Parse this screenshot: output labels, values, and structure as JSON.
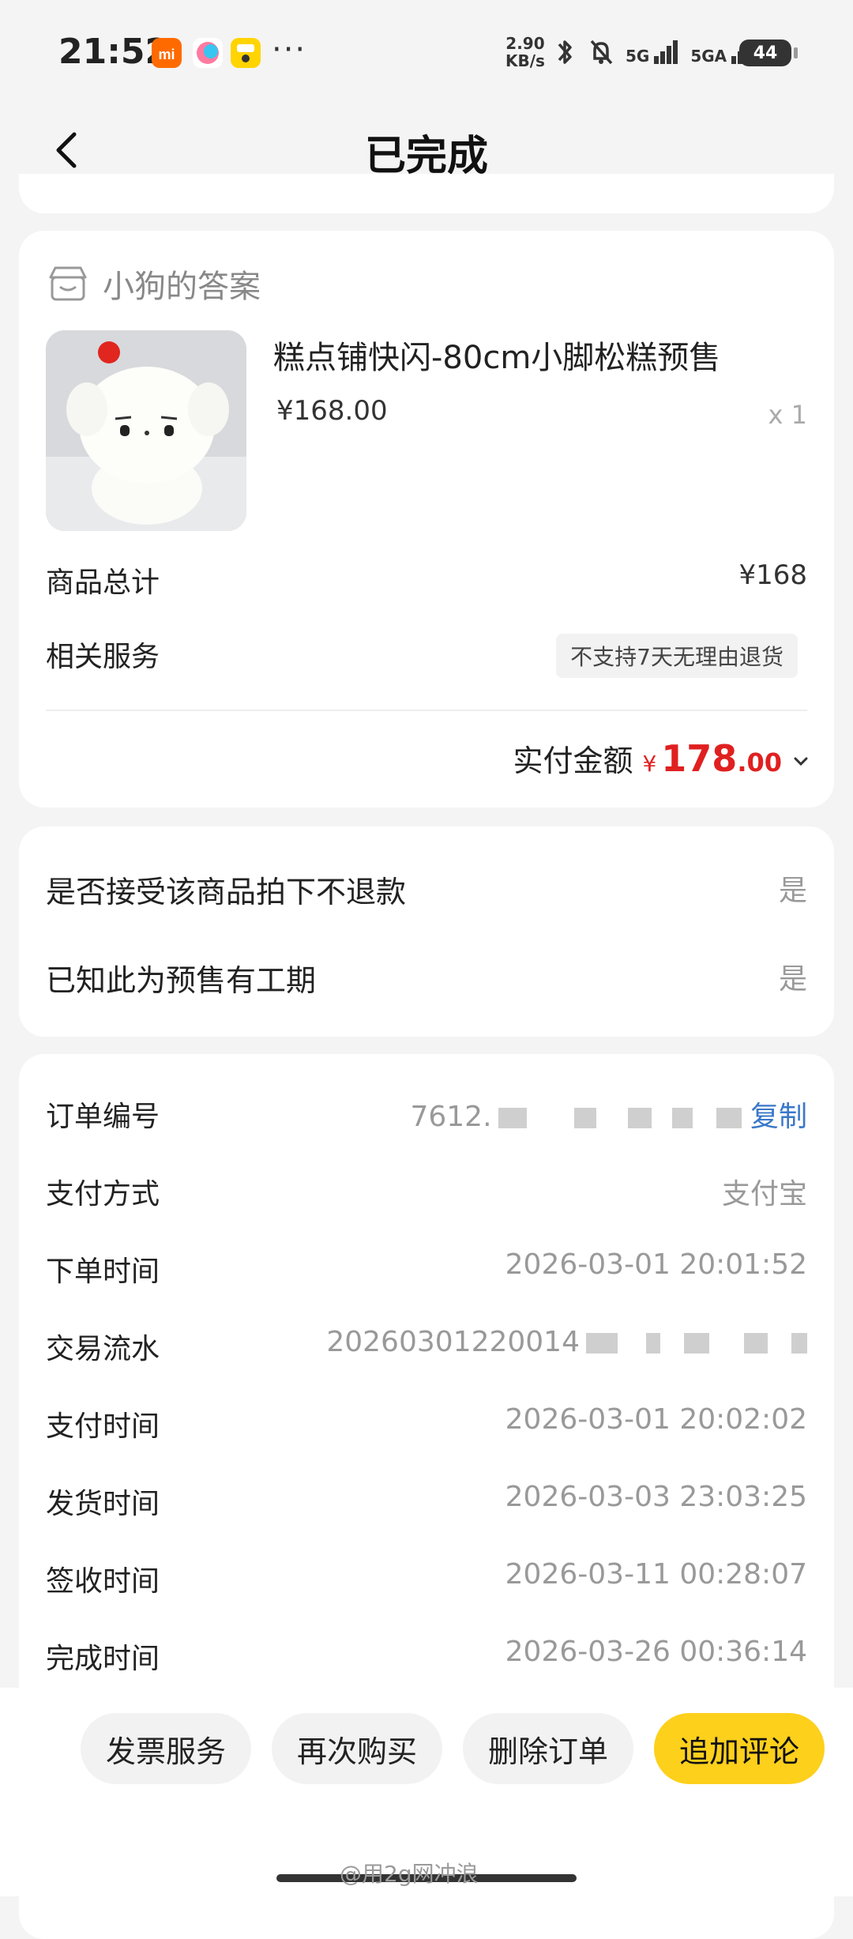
{
  "status_bar": {
    "time": "21:52",
    "net_speed": "2.90",
    "net_unit": "KB/s",
    "signal1_label": "5G",
    "signal2_label": "5GA",
    "battery": "44",
    "icons": [
      "mi-app-icon",
      "colorful-app-icon",
      "yellow-app-icon",
      "bluetooth-icon",
      "mute-bell-icon",
      "signal-icon"
    ]
  },
  "header": {
    "title": "已完成"
  },
  "product_card": {
    "shop_name": "小狗的答案",
    "product_title": "糕点铺快闪-80cm小脚松糕预售",
    "price": "¥168.00",
    "qty": "x 1",
    "total_label": "商品总计",
    "total_value": "¥168",
    "service_label": "相关服务",
    "service_tag": "不支持7天无理由退货",
    "paid_label": "实付金额",
    "paid_currency": "¥",
    "paid_int": "178",
    "paid_dec": ".00"
  },
  "options": [
    {
      "label": "是否接受该商品拍下不退款",
      "value": "是"
    },
    {
      "label": "已知此为预售有工期",
      "value": "是"
    }
  ],
  "order_info": {
    "order_no_label": "订单编号",
    "order_no_value": "7612.",
    "copy_label": "复制",
    "pay_method_label": "支付方式",
    "pay_method_value": "支付宝",
    "order_time_label": "下单时间",
    "order_time_value": "2026-03-01 20:01:52",
    "txn_label": "交易流水",
    "txn_value": "20260301220014",
    "pay_time_label": "支付时间",
    "pay_time_value": "2026-03-01 20:02:02",
    "ship_time_label": "发货时间",
    "ship_time_value": "2026-03-03 23:03:25",
    "sign_time_label": "签收时间",
    "sign_time_value": "2026-03-11 00:28:07",
    "done_time_label": "完成时间",
    "done_time_value": "2026-03-26 00:36:14"
  },
  "bottom_buttons": {
    "invoice": "发票服务",
    "rebuy": "再次购买",
    "delete": "删除订单",
    "review": "追加评论"
  },
  "watermark": "@用2g网冲浪",
  "colors": {
    "accent_yellow": "#fdd01c",
    "price_red": "#e02020",
    "link_blue": "#3a78c9"
  }
}
